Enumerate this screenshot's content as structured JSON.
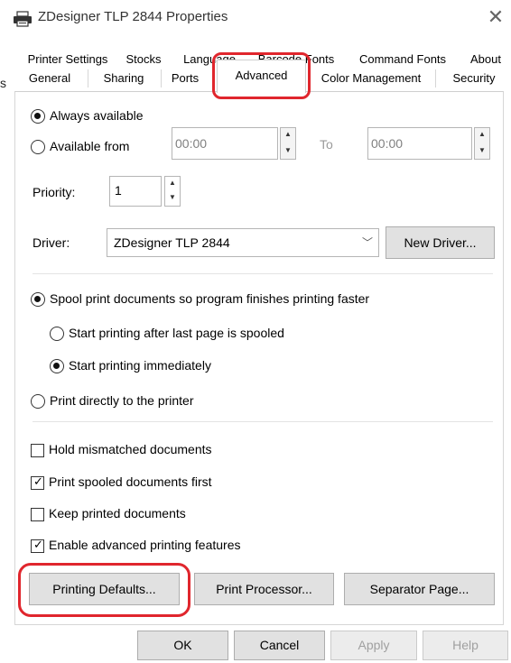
{
  "window": {
    "title": "ZDesigner TLP 2844 Properties",
    "close_glyph": "✕"
  },
  "tabs": {
    "row1": [
      "Printer Settings",
      "Stocks",
      "Language",
      "Barcode Fonts",
      "Command Fonts",
      "About"
    ],
    "row2": [
      "General",
      "Sharing",
      "Ports",
      "Advanced",
      "Color Management",
      "Security"
    ],
    "active": "Advanced"
  },
  "availability": {
    "always_label": "Always available",
    "from_label": "Available from",
    "from_time": "00:00",
    "to_label": "To",
    "to_time": "00:00",
    "selected": "always"
  },
  "priority": {
    "label": "Priority:",
    "value": "1"
  },
  "driver": {
    "label": "Driver:",
    "value": "ZDesigner TLP 2844",
    "new_driver_button": "New Driver..."
  },
  "spool": {
    "spool_label": "Spool print documents so program finishes printing faster",
    "after_last_label": "Start printing after last page is spooled",
    "immediately_label": "Start printing immediately",
    "direct_label": "Print directly to the printer",
    "selected_main": "spool",
    "selected_sub": "immediately"
  },
  "options": {
    "hold_mismatched": {
      "label": "Hold mismatched documents",
      "checked": false
    },
    "print_spooled_first": {
      "label": "Print spooled documents first",
      "checked": true
    },
    "keep_printed": {
      "label": "Keep printed documents",
      "checked": false
    },
    "enable_advanced": {
      "label": "Enable advanced printing features",
      "checked": true
    }
  },
  "page_buttons": {
    "printing_defaults": "Printing Defaults...",
    "print_processor": "Print Processor...",
    "separator_page": "Separator Page..."
  },
  "dialog_buttons": {
    "ok": "OK",
    "cancel": "Cancel",
    "apply": "Apply",
    "help": "Help"
  },
  "colors": {
    "highlight": "#e0262d"
  }
}
